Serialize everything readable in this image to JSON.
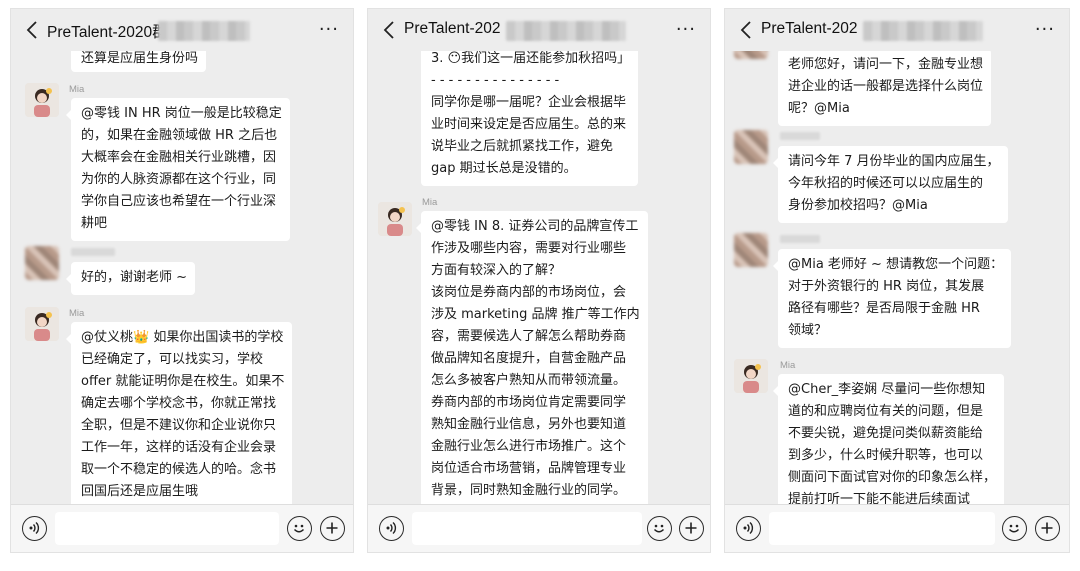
{
  "panels": [
    {
      "title": "PreTalent-2020群",
      "more_label": "···",
      "messages": [
        {
          "kind": "bubble",
          "continuation": true,
          "text": "还算是应届生身份吗"
        },
        {
          "kind": "message",
          "sender": "Mia",
          "text": "@零钱 IN HR 岗位一般是比较稳定\n的，如果在金融领域做 HR 之后也\n大概率会在金融相关行业跳槽，因\n为你的人脉资源都在这个行业，同\n学你自己应该也希望在一个行业深\n耕吧"
        },
        {
          "kind": "message",
          "sender": "",
          "text": "好的，谢谢老师 ~"
        },
        {
          "kind": "message",
          "sender": "Mia",
          "text": "@仗义桃👑 如果你出国读书的学校\n已经确定了，可以找实习，学校\noffer 就能证明你是在校生。如果不\n确定去哪个学校念书，你就正常找\n全职，但是不建议你和企业说你只\n工作一年，这样的话没有企业会录\n取一个不稳定的候选人的哈。念书\n回国后还是应届生哦"
        }
      ]
    },
    {
      "title": "PreTalent-202",
      "more_label": "···",
      "messages": [
        {
          "kind": "bubble",
          "continuation": true,
          "text": "3. 😶我们这一届还能参加秋招吗」\n- - - - - - - - - - - - - - -\n同学你是哪一届呢？企业会根据毕\n业时间来设定是否应届生。总的来\n说毕业之后就抓紧找工作，避免\ngap 期过长总是没错的。"
        },
        {
          "kind": "message",
          "sender": "Mia",
          "text": "@零钱 IN 8. 证券公司的品牌宣传工\n作涉及哪些内容，需要对行业哪些\n方面有较深入的了解？\n该岗位是券商内部的市场岗位，会\n涉及 marketing 品牌 推广等工作内\n容，需要候选人了解怎么帮助券商\n做品牌知名度提升，自营金融产品\n怎么多被客户熟知从而带领流量。\n券商内部的市场岗位肯定需要同学\n熟知金融行业信息，另外也要知道\n金融行业怎么进行市场推广。这个\n岗位适合市场营销，品牌管理专业\n背景，同时熟知金融行业的同学。"
        }
      ]
    },
    {
      "title": "PreTalent-202",
      "more_label": "···",
      "messages": [
        {
          "kind": "bubble",
          "continuation": true,
          "text": "老师您好，请问一下，金融专业想\n进企业的话一般都是选择什么岗位\n呢？@Mia"
        },
        {
          "kind": "message",
          "sender": "",
          "text": "请问今年 7 月份毕业的国内应届生，\n今年秋招的时候还可以以应届生的\n身份参加校招吗？@Mia"
        },
        {
          "kind": "message",
          "sender": "",
          "text": "@Mia 老师好 ~ 想请教您一个问题：\n对于外资银行的 HR 岗位，其发展\n路径有哪些？是否局限于金融 HR\n领域？"
        },
        {
          "kind": "message",
          "sender": "Mia",
          "text": "@Cher_李姿娴 尽量问一些你想知\n道的和应聘岗位有关的问题，但是\n不要尖锐，避免提问类似薪资能给\n到多少，什么时候升职等，也可以\n侧面问下面试官对你的印象怎么样，\n提前打听一下能不能进后续面试"
        }
      ]
    }
  ],
  "colors": {
    "background": "#ededed",
    "bubble": "#ffffff",
    "text": "#1b1b1b",
    "sender_name": "#9a9a9a"
  },
  "icons": [
    "back-chevron-icon",
    "more-icon",
    "voice-icon",
    "emoji-icon",
    "plus-icon"
  ]
}
